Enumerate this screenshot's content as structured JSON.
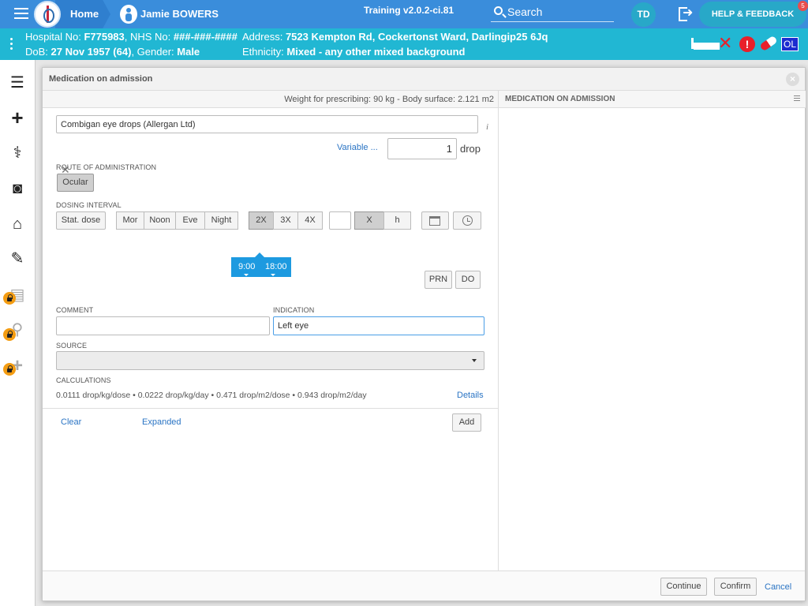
{
  "topbar": {
    "home_label": "Home",
    "patient_name": "Jamie BOWERS",
    "version": "Training v2.0.2-ci.81",
    "search_label": "Search",
    "user_initials": "TD",
    "help_label": "HELP & FEEDBACK",
    "help_badge": "5"
  },
  "banner": {
    "hospital_label": "Hospital No:",
    "hospital_no": "F775983",
    "nhs_label": ", NHS No:",
    "nhs_no": "###-###-####",
    "dob_label": "DoB:",
    "dob": "27 Nov 1957 (64)",
    "gender_label": ", Gender:",
    "gender": "Male",
    "address_label": "Address:",
    "address": "7523 Kempton Rd, Cockertonst Ward, Darlingip25 6Jq",
    "ethnicity_label": "Ethnicity:",
    "ethnicity": "Mixed - any other mixed background",
    "ol_badge": "OL",
    "alert_icon_text": "!"
  },
  "modal": {
    "title": "Medication on admission",
    "weight_text": "Weight for prescribing: 90 kg - Body surface: 2.121 m2",
    "drug_value": "Combigan eye drops (Allergan Ltd)",
    "variable_link": "Variable ...",
    "dose_value": "1",
    "dose_unit": "drop",
    "route_label": "ROUTE OF ADMINISTRATION",
    "route_value": "Ocular",
    "dosing_label": "DOSING INTERVAL",
    "stat_dose": "Stat. dose",
    "times_of_day": [
      "Mor",
      "Noon",
      "Eve",
      "Night"
    ],
    "frequency": [
      "2X",
      "3X",
      "4X"
    ],
    "interval_x": "X",
    "interval_h": "h",
    "times": [
      "9:00",
      "18:00"
    ],
    "prn": "PRN",
    "do": "DO",
    "comment_label": "COMMENT",
    "comment_value": "",
    "indication_label": "INDICATION",
    "indication_value": "Left eye",
    "source_label": "SOURCE",
    "calculations_label": "CALCULATIONS",
    "calculations_text": "0.0111 drop/kg/dose • 0.0222 drop/kg/day • 0.471 drop/m2/dose • 0.943 drop/m2/day",
    "details_link": "Details",
    "clear_link": "Clear",
    "expanded_link": "Expanded",
    "add_button": "Add",
    "right_title": "MEDICATION ON ADMISSION",
    "continue_button": "Continue",
    "confirm_button": "Confirm",
    "cancel_link": "Cancel"
  },
  "colors": {
    "topbar": "#3a8ddb",
    "banner": "#21b7d3",
    "time_highlight": "#1d9ae0",
    "link": "#2a74c4"
  }
}
